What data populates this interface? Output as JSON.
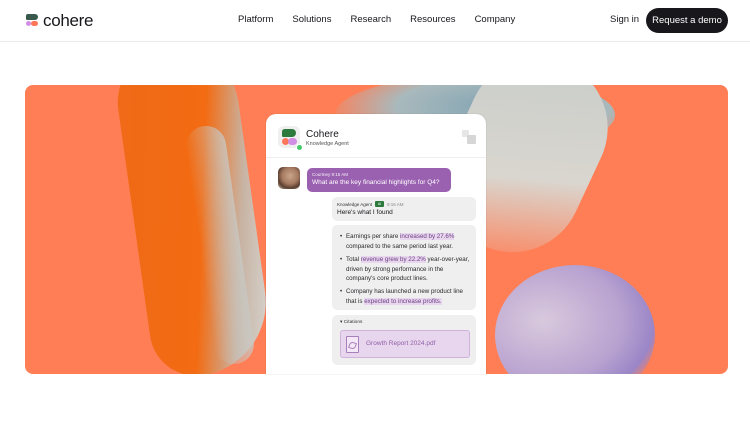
{
  "nav": {
    "brand": "cohere",
    "links": [
      "Platform",
      "Solutions",
      "Research",
      "Resources",
      "Company"
    ],
    "signin": "Sign in",
    "cta": "Request a demo"
  },
  "hero": {
    "card": {
      "agent_name": "Cohere",
      "agent_role": "Knowledge Agent",
      "user_meta": "Courtney  9:15 AM",
      "user_message": "What are the key financial highlights for Q4?",
      "reply_label": "Knowledge Agent",
      "reply_badge": "AI",
      "reply_time": "9:16 AM",
      "reply_intro": "Here's what I found",
      "bullets": [
        {
          "pre": "Earnings per share ",
          "hl": "increased by 27.6%",
          "post": " compared to the same period last year."
        },
        {
          "pre": "Total ",
          "hl": "revenue grew by 22.2%",
          "post": " year-over-year, driven by strong performance in the company's core product lines."
        },
        {
          "pre": "Company has launched a new product line that is ",
          "hl": "expected to increase profits.",
          "post": ""
        }
      ],
      "citations_label": "Citations",
      "citation_file": "Growth Report 2024.pdf"
    }
  },
  "icons": {
    "logo": "cohere-logo-icon",
    "agent": "cohere-agent-icon",
    "expand": "expand-icon",
    "pdf": "pdf-file-icon",
    "caret": "caret-down-icon"
  },
  "colors": {
    "hero_bg": "#ff7e55",
    "user_bubble": "#9b61b1",
    "highlight": "#e8d6ee",
    "cta_bg": "#17171c"
  }
}
